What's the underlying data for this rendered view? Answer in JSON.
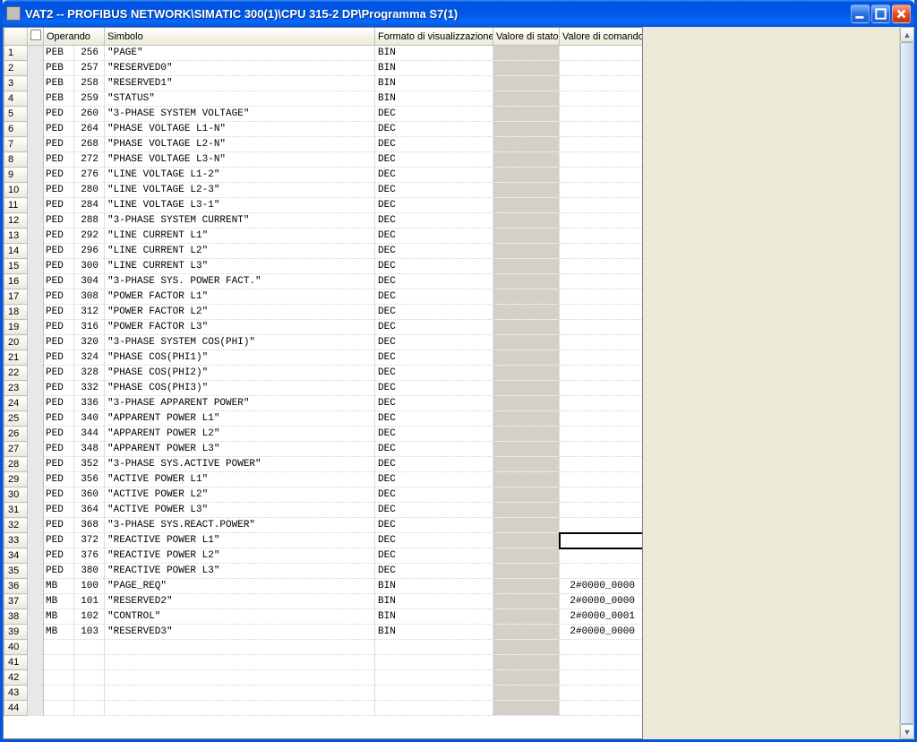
{
  "window": {
    "title": "VAT2 -- PROFIBUS NETWORK\\SIMATIC 300(1)\\CPU 315-2 DP\\Programma S7(1)"
  },
  "columns": {
    "rownum": "",
    "mark": "",
    "operando": "Operando",
    "simbolo": "Simbolo",
    "formato": "Formato di visualizzazione",
    "stato": "Valore di stato",
    "comando": "Valore di comando"
  },
  "rows": [
    {
      "n": "1",
      "op": "PEB",
      "addr": "256",
      "sym": "\"PAGE\"",
      "fmt": "BIN",
      "stato": "",
      "cmd": ""
    },
    {
      "n": "2",
      "op": "PEB",
      "addr": "257",
      "sym": "\"RESERVED0\"",
      "fmt": "BIN",
      "stato": "",
      "cmd": ""
    },
    {
      "n": "3",
      "op": "PEB",
      "addr": "258",
      "sym": "\"RESERVED1\"",
      "fmt": "BIN",
      "stato": "",
      "cmd": ""
    },
    {
      "n": "4",
      "op": "PEB",
      "addr": "259",
      "sym": "\"STATUS\"",
      "fmt": "BIN",
      "stato": "",
      "cmd": ""
    },
    {
      "n": "5",
      "op": "PED",
      "addr": "260",
      "sym": "\"3-PHASE SYSTEM VOLTAGE\"",
      "fmt": "DEC",
      "stato": "",
      "cmd": ""
    },
    {
      "n": "6",
      "op": "PED",
      "addr": "264",
      "sym": "\"PHASE VOLTAGE L1-N\"",
      "fmt": "DEC",
      "stato": "",
      "cmd": ""
    },
    {
      "n": "7",
      "op": "PED",
      "addr": "268",
      "sym": "\"PHASE VOLTAGE L2-N\"",
      "fmt": "DEC",
      "stato": "",
      "cmd": ""
    },
    {
      "n": "8",
      "op": "PED",
      "addr": "272",
      "sym": "\"PHASE VOLTAGE L3-N\"",
      "fmt": "DEC",
      "stato": "",
      "cmd": ""
    },
    {
      "n": "9",
      "op": "PED",
      "addr": "276",
      "sym": "\"LINE VOLTAGE L1-2\"",
      "fmt": "DEC",
      "stato": "",
      "cmd": ""
    },
    {
      "n": "10",
      "op": "PED",
      "addr": "280",
      "sym": "\"LINE VOLTAGE L2-3\"",
      "fmt": "DEC",
      "stato": "",
      "cmd": ""
    },
    {
      "n": "11",
      "op": "PED",
      "addr": "284",
      "sym": "\"LINE VOLTAGE L3-1\"",
      "fmt": "DEC",
      "stato": "",
      "cmd": ""
    },
    {
      "n": "12",
      "op": "PED",
      "addr": "288",
      "sym": "\"3-PHASE SYSTEM CURRENT\"",
      "fmt": "DEC",
      "stato": "",
      "cmd": ""
    },
    {
      "n": "13",
      "op": "PED",
      "addr": "292",
      "sym": "\"LINE CURRENT L1\"",
      "fmt": "DEC",
      "stato": "",
      "cmd": ""
    },
    {
      "n": "14",
      "op": "PED",
      "addr": "296",
      "sym": "\"LINE CURRENT L2\"",
      "fmt": "DEC",
      "stato": "",
      "cmd": ""
    },
    {
      "n": "15",
      "op": "PED",
      "addr": "300",
      "sym": "\"LINE CURRENT L3\"",
      "fmt": "DEC",
      "stato": "",
      "cmd": ""
    },
    {
      "n": "16",
      "op": "PED",
      "addr": "304",
      "sym": "\"3-PHASE SYS. POWER FACT.\"",
      "fmt": "DEC",
      "stato": "",
      "cmd": ""
    },
    {
      "n": "17",
      "op": "PED",
      "addr": "308",
      "sym": "\"POWER FACTOR L1\"",
      "fmt": "DEC",
      "stato": "",
      "cmd": ""
    },
    {
      "n": "18",
      "op": "PED",
      "addr": "312",
      "sym": "\"POWER FACTOR L2\"",
      "fmt": "DEC",
      "stato": "",
      "cmd": ""
    },
    {
      "n": "19",
      "op": "PED",
      "addr": "316",
      "sym": "\"POWER FACTOR L3\"",
      "fmt": "DEC",
      "stato": "",
      "cmd": ""
    },
    {
      "n": "20",
      "op": "PED",
      "addr": "320",
      "sym": "\"3-PHASE SYSTEM COS(PHI)\"",
      "fmt": "DEC",
      "stato": "",
      "cmd": ""
    },
    {
      "n": "21",
      "op": "PED",
      "addr": "324",
      "sym": "\"PHASE COS(PHI1)\"",
      "fmt": "DEC",
      "stato": "",
      "cmd": ""
    },
    {
      "n": "22",
      "op": "PED",
      "addr": "328",
      "sym": "\"PHASE COS(PHI2)\"",
      "fmt": "DEC",
      "stato": "",
      "cmd": ""
    },
    {
      "n": "23",
      "op": "PED",
      "addr": "332",
      "sym": "\"PHASE COS(PHI3)\"",
      "fmt": "DEC",
      "stato": "",
      "cmd": ""
    },
    {
      "n": "24",
      "op": "PED",
      "addr": "336",
      "sym": "\"3-PHASE APPARENT POWER\"",
      "fmt": "DEC",
      "stato": "",
      "cmd": ""
    },
    {
      "n": "25",
      "op": "PED",
      "addr": "340",
      "sym": "\"APPARENT POWER L1\"",
      "fmt": "DEC",
      "stato": "",
      "cmd": ""
    },
    {
      "n": "26",
      "op": "PED",
      "addr": "344",
      "sym": "\"APPARENT POWER L2\"",
      "fmt": "DEC",
      "stato": "",
      "cmd": ""
    },
    {
      "n": "27",
      "op": "PED",
      "addr": "348",
      "sym": "\"APPARENT POWER L3\"",
      "fmt": "DEC",
      "stato": "",
      "cmd": ""
    },
    {
      "n": "28",
      "op": "PED",
      "addr": "352",
      "sym": "\"3-PHASE SYS.ACTIVE POWER\"",
      "fmt": "DEC",
      "stato": "",
      "cmd": ""
    },
    {
      "n": "29",
      "op": "PED",
      "addr": "356",
      "sym": "\"ACTIVE POWER L1\"",
      "fmt": "DEC",
      "stato": "",
      "cmd": ""
    },
    {
      "n": "30",
      "op": "PED",
      "addr": "360",
      "sym": "\"ACTIVE POWER L2\"",
      "fmt": "DEC",
      "stato": "",
      "cmd": ""
    },
    {
      "n": "31",
      "op": "PED",
      "addr": "364",
      "sym": "\"ACTIVE POWER L3\"",
      "fmt": "DEC",
      "stato": "",
      "cmd": ""
    },
    {
      "n": "32",
      "op": "PED",
      "addr": "368",
      "sym": "\"3-PHASE SYS.REACT.POWER\"",
      "fmt": "DEC",
      "stato": "",
      "cmd": ""
    },
    {
      "n": "33",
      "op": "PED",
      "addr": "372",
      "sym": "\"REACTIVE POWER L1\"",
      "fmt": "DEC",
      "stato": "",
      "cmd": "",
      "selected": true
    },
    {
      "n": "34",
      "op": "PED",
      "addr": "376",
      "sym": "\"REACTIVE POWER L2\"",
      "fmt": "DEC",
      "stato": "",
      "cmd": ""
    },
    {
      "n": "35",
      "op": "PED",
      "addr": "380",
      "sym": "\"REACTIVE POWER L3\"",
      "fmt": "DEC",
      "stato": "",
      "cmd": ""
    },
    {
      "n": "36",
      "op": "MB",
      "addr": "100",
      "sym": "\"PAGE_REQ\"",
      "fmt": "BIN",
      "stato": "",
      "cmd": "2#0000_0000"
    },
    {
      "n": "37",
      "op": "MB",
      "addr": "101",
      "sym": "\"RESERVED2\"",
      "fmt": "BIN",
      "stato": "",
      "cmd": "2#0000_0000"
    },
    {
      "n": "38",
      "op": "MB",
      "addr": "102",
      "sym": "\"CONTROL\"",
      "fmt": "BIN",
      "stato": "",
      "cmd": "2#0000_0001"
    },
    {
      "n": "39",
      "op": "MB",
      "addr": "103",
      "sym": "\"RESERVED3\"",
      "fmt": "BIN",
      "stato": "",
      "cmd": "2#0000_0000"
    },
    {
      "n": "40",
      "op": "",
      "addr": "",
      "sym": "",
      "fmt": "",
      "stato": "",
      "cmd": ""
    },
    {
      "n": "41",
      "op": "",
      "addr": "",
      "sym": "",
      "fmt": "",
      "stato": "",
      "cmd": ""
    },
    {
      "n": "42",
      "op": "",
      "addr": "",
      "sym": "",
      "fmt": "",
      "stato": "",
      "cmd": ""
    },
    {
      "n": "43",
      "op": "",
      "addr": "",
      "sym": "",
      "fmt": "",
      "stato": "",
      "cmd": ""
    },
    {
      "n": "44",
      "op": "",
      "addr": "",
      "sym": "",
      "fmt": "",
      "stato": "",
      "cmd": ""
    }
  ],
  "colwidths": {
    "rownum": 26,
    "mark": 18,
    "opcode": 34,
    "opaddr": 34,
    "sym": 302,
    "fmt": 132,
    "stato": 74,
    "cmd": 93
  }
}
